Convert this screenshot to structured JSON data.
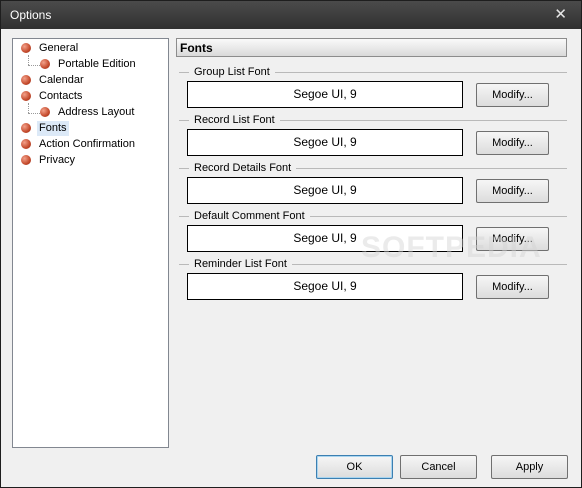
{
  "window": {
    "title": "Options",
    "close_glyph": "✕"
  },
  "tree": {
    "items": [
      {
        "label": "General",
        "level": 0
      },
      {
        "label": "Portable Edition",
        "level": 1
      },
      {
        "label": "Calendar",
        "level": 0
      },
      {
        "label": "Contacts",
        "level": 0
      },
      {
        "label": "Address Layout",
        "level": 1
      },
      {
        "label": "Fonts",
        "level": 0,
        "selected": true
      },
      {
        "label": "Action Confirmation",
        "level": 0
      },
      {
        "label": "Privacy",
        "level": 0
      }
    ]
  },
  "panel": {
    "header": "Fonts",
    "groups": [
      {
        "label": "Group List Font",
        "value": "Segoe UI, 9",
        "button": "Modify..."
      },
      {
        "label": "Record List Font",
        "value": "Segoe UI, 9",
        "button": "Modify..."
      },
      {
        "label": "Record Details Font",
        "value": "Segoe UI, 9",
        "button": "Modify..."
      },
      {
        "label": "Default Comment Font",
        "value": "Segoe UI, 9",
        "button": "Modify..."
      },
      {
        "label": "Reminder List Font",
        "value": "Segoe UI, 9",
        "button": "Modify..."
      }
    ]
  },
  "footer": {
    "ok": "OK",
    "cancel": "Cancel",
    "apply": "Apply"
  },
  "watermark": "SOFTPEDIA",
  "colors": {
    "titlebar": "#3a3a3a",
    "selection": "#dce9f7",
    "bullet": "#c44a2c"
  }
}
